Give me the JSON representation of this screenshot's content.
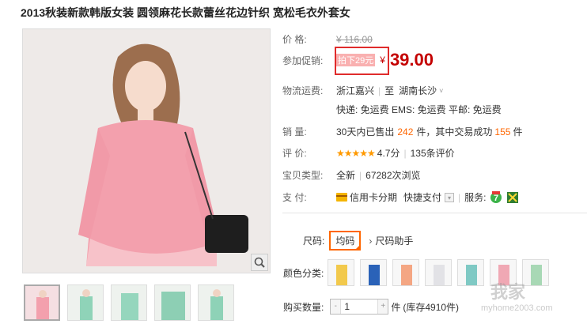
{
  "title": "2013秋装新款韩版女装 圆领麻花长款蕾丝花边针织 宽松毛衣外套女",
  "price": {
    "label": "价      格:",
    "original": "¥ 116.00"
  },
  "promo": {
    "label": "参加促销:",
    "tag": "拍下29元",
    "currency": "¥",
    "value": "39.00"
  },
  "shipping": {
    "label": "物流运费:",
    "from": "浙江嘉兴",
    "to_prefix": "至",
    "to": "湖南长沙",
    "methods": "快递: 免运费  EMS: 免运费  平邮: 免运费"
  },
  "sales": {
    "label": "销      量:",
    "pre": "30天内已售出",
    "count": "242",
    "mid": "件，其中交易成功",
    "success": "155",
    "post": "件"
  },
  "rating": {
    "label": "评      价:",
    "stars": "★★★★★",
    "score": "4.7分",
    "reviews": "135条评价"
  },
  "item_type": {
    "label": "宝贝类型:",
    "value": "全新",
    "views": "67282次浏览"
  },
  "payment": {
    "label": "支      付:",
    "credit": "信用卡分期",
    "express": "快捷支付",
    "service_label": "服务:"
  },
  "size": {
    "label": "尺码:",
    "selected": "均码",
    "helper": "尺码助手"
  },
  "color": {
    "label": "颜色分类:",
    "swatches": [
      "#f2c94c",
      "#2a62b8",
      "#f4a683",
      "#e8e8ea",
      "#7fc9c4",
      "#f0a8b4",
      "#a8d8b5"
    ]
  },
  "quantity": {
    "label": "购买数量:",
    "value": "1",
    "unit": "件",
    "stock": "(库存4910件)"
  },
  "watermark": {
    "main": "我家",
    "sub": "myhome2003.com"
  }
}
